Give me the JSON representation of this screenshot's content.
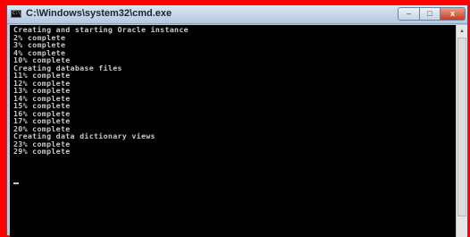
{
  "window": {
    "title": "C:\\Windows\\system32\\cmd.exe",
    "icon_label": "C:\\",
    "controls": {
      "minimize": "–",
      "maximize": "□",
      "close": "x"
    }
  },
  "console": {
    "lines": [
      "Creating and starting Oracle instance",
      "2% complete",
      "3% complete",
      "4% complete",
      "10% complete",
      "Creating database files",
      "11% complete",
      "12% complete",
      "13% complete",
      "14% complete",
      "15% complete",
      "16% complete",
      "17% complete",
      "20% complete",
      "Creating data dictionary views",
      "23% complete",
      "29% complete"
    ]
  },
  "scrollbar": {
    "up_arrow": "▲"
  },
  "colors": {
    "background": "#ff0000",
    "console_bg": "#000000",
    "console_text": "#c8c8c8"
  }
}
